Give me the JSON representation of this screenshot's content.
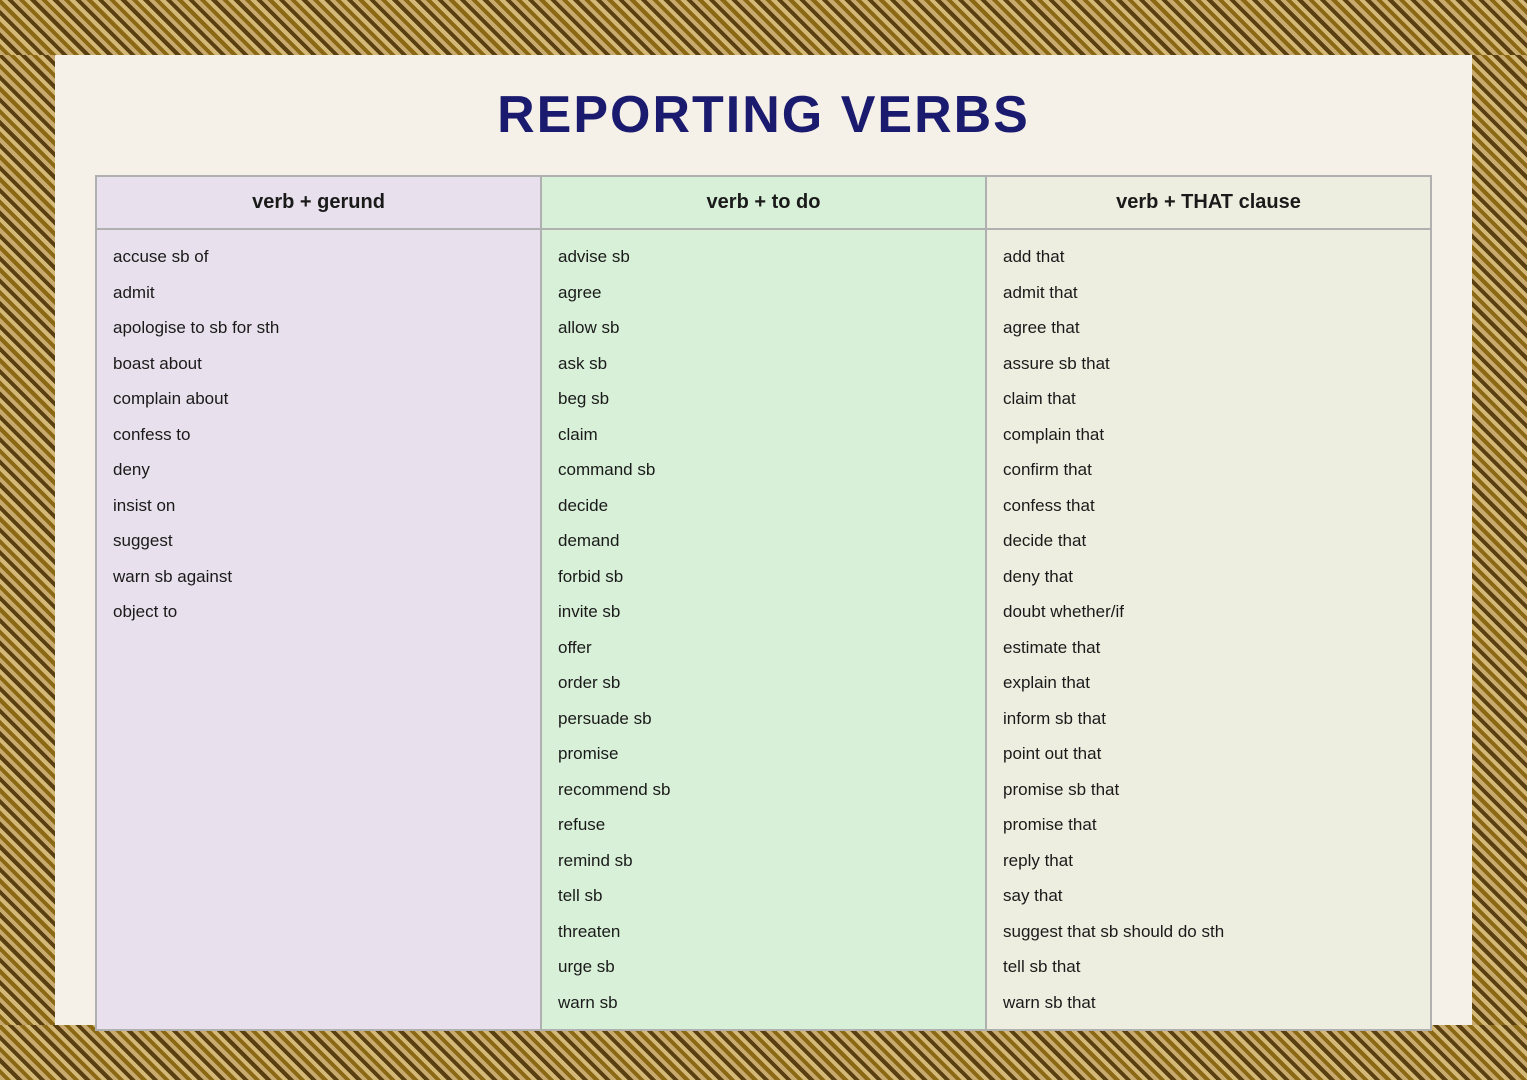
{
  "title": "REPORTING VERBS",
  "columns": [
    {
      "id": "gerund",
      "header": "verb + gerund",
      "items": [
        "accuse sb of",
        "admit",
        "apologise to sb for sth",
        "boast about",
        "complain about",
        "confess to",
        "deny",
        "insist on",
        "suggest",
        "warn sb against",
        "object to"
      ]
    },
    {
      "id": "todo",
      "header": "verb + to do",
      "items": [
        "advise sb",
        "agree",
        "allow sb",
        "ask sb",
        "beg sb",
        "claim",
        "command sb",
        "decide",
        "demand",
        "forbid sb",
        "invite sb",
        "offer",
        "order sb",
        "persuade sb",
        "promise",
        "recommend sb",
        "refuse",
        "remind sb",
        "tell sb",
        "threaten",
        "urge sb",
        "warn sb"
      ]
    },
    {
      "id": "that",
      "header": "verb + THAT clause",
      "items": [
        "add that",
        "admit that",
        "agree that",
        "assure sb that",
        "claim that",
        "complain that",
        "confirm that",
        "confess that",
        "decide that",
        "deny that",
        "doubt whether/if",
        "estimate that",
        "explain that",
        "inform sb that",
        "point out that",
        "promise sb that",
        "promise that",
        "reply that",
        "say that",
        "suggest that sb should do sth",
        "tell sb that",
        "warn sb that"
      ]
    }
  ]
}
